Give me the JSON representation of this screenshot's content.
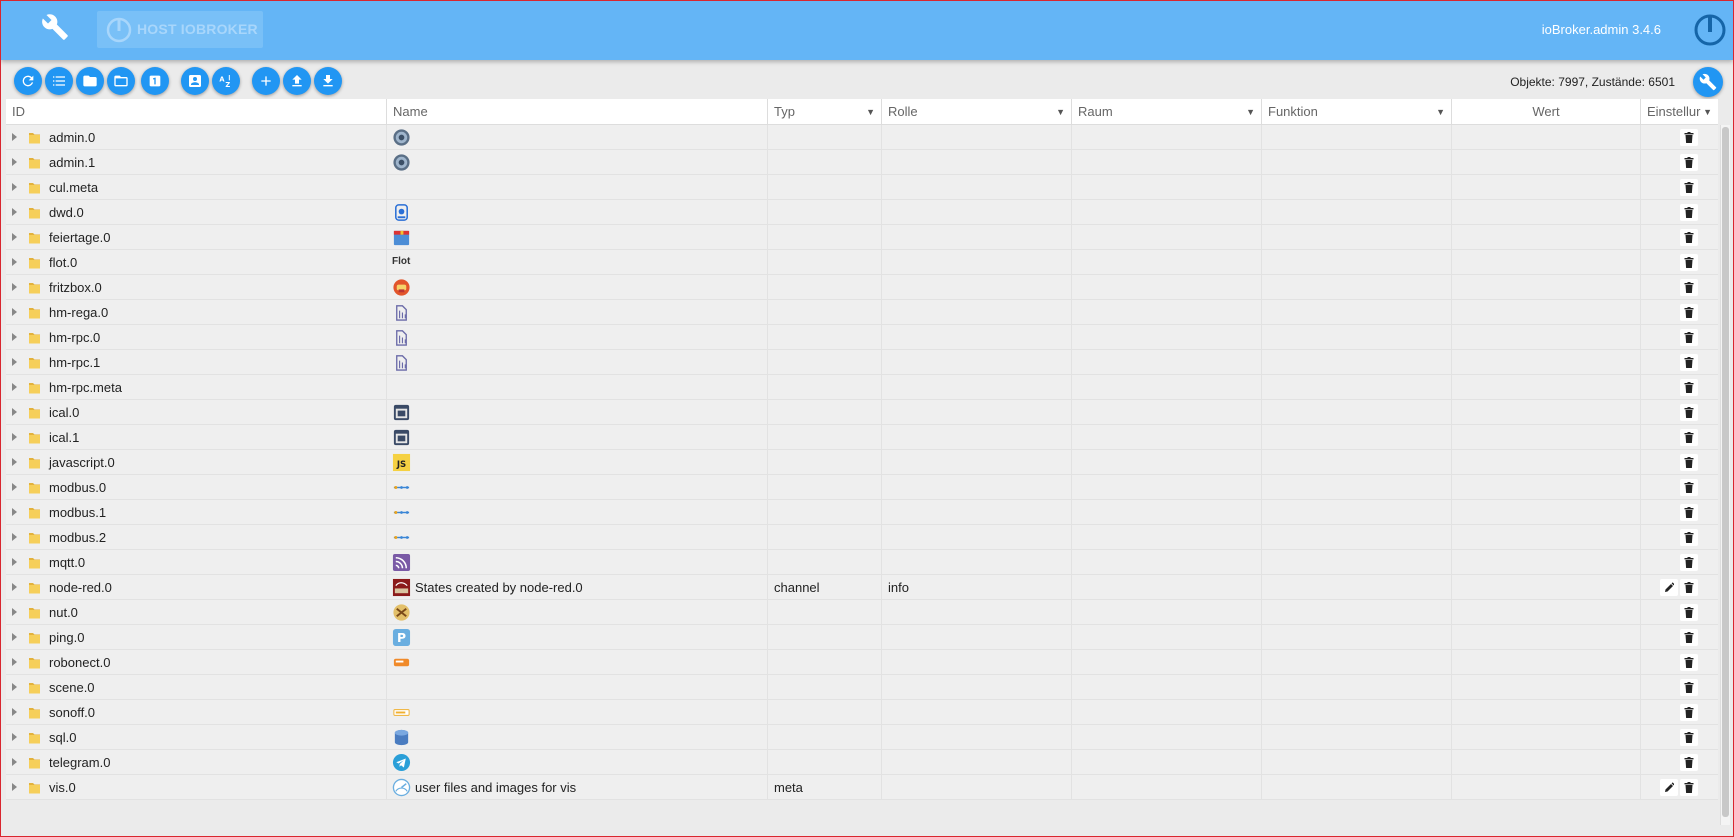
{
  "header": {
    "host_tab": "HOST IOBROKER",
    "version": "ioBroker.admin 3.4.6",
    "colors": {
      "bar": "#64b5f6",
      "accent": "#2196f3"
    }
  },
  "toolbar": {
    "buttons": [
      "refresh-icon",
      "list-view-icon",
      "folder-closed-icon",
      "folder-open-icon",
      "count-one-icon",
      "contact-card-icon",
      "sort-az-icon",
      "add-icon",
      "upload-icon",
      "download-icon"
    ],
    "counts": "Objekte: 7997, Zustände: 6501"
  },
  "table": {
    "headers": {
      "id": "ID",
      "name": "Name",
      "typ": "Typ",
      "rolle": "Rolle",
      "raum": "Raum",
      "funktion": "Funktion",
      "wert": "Wert",
      "einstellungen": "Einstellur"
    },
    "rows": [
      {
        "id": "admin.0",
        "icon": "admin-gear-icon",
        "name": "",
        "typ": "",
        "rolle": "",
        "edit": false
      },
      {
        "id": "admin.1",
        "icon": "admin-gear-icon",
        "name": "",
        "typ": "",
        "rolle": "",
        "edit": false
      },
      {
        "id": "cul.meta",
        "icon": "",
        "name": "",
        "typ": "",
        "rolle": "",
        "edit": false
      },
      {
        "id": "dwd.0",
        "icon": "dwd-weather-icon",
        "name": "",
        "typ": "",
        "rolle": "",
        "edit": false
      },
      {
        "id": "feiertage.0",
        "icon": "calendar-24-icon",
        "name": "",
        "typ": "",
        "rolle": "",
        "edit": false
      },
      {
        "id": "flot.0",
        "icon": "flot-text-icon",
        "icon_text": "Flot",
        "name": "",
        "typ": "",
        "rolle": "",
        "edit": false
      },
      {
        "id": "fritzbox.0",
        "icon": "fritzbox-phone-icon",
        "name": "",
        "typ": "",
        "rolle": "",
        "edit": false
      },
      {
        "id": "hm-rega.0",
        "icon": "homematic-icon",
        "name": "",
        "typ": "",
        "rolle": "",
        "edit": false
      },
      {
        "id": "hm-rpc.0",
        "icon": "homematic-icon",
        "name": "",
        "typ": "",
        "rolle": "",
        "edit": false
      },
      {
        "id": "hm-rpc.1",
        "icon": "homematic-icon",
        "name": "",
        "typ": "",
        "rolle": "",
        "edit": false
      },
      {
        "id": "hm-rpc.meta",
        "icon": "",
        "name": "",
        "typ": "",
        "rolle": "",
        "edit": false
      },
      {
        "id": "ical.0",
        "icon": "ical-calendar-icon",
        "name": "",
        "typ": "",
        "rolle": "",
        "edit": false
      },
      {
        "id": "ical.1",
        "icon": "ical-calendar-icon",
        "name": "",
        "typ": "",
        "rolle": "",
        "edit": false
      },
      {
        "id": "javascript.0",
        "icon": "javascript-icon",
        "icon_text": "JS",
        "name": "",
        "typ": "",
        "rolle": "",
        "edit": false
      },
      {
        "id": "modbus.0",
        "icon": "modbus-icon",
        "name": "",
        "typ": "",
        "rolle": "",
        "edit": false
      },
      {
        "id": "modbus.1",
        "icon": "modbus-icon",
        "name": "",
        "typ": "",
        "rolle": "",
        "edit": false
      },
      {
        "id": "modbus.2",
        "icon": "modbus-icon",
        "name": "",
        "typ": "",
        "rolle": "",
        "edit": false
      },
      {
        "id": "mqtt.0",
        "icon": "mqtt-signal-icon",
        "name": "",
        "typ": "",
        "rolle": "",
        "edit": false
      },
      {
        "id": "node-red.0",
        "icon": "node-red-icon",
        "name": "States created by node-red.0",
        "typ": "channel",
        "rolle": "info",
        "edit": true
      },
      {
        "id": "nut.0",
        "icon": "nut-ups-icon",
        "name": "",
        "typ": "",
        "rolle": "",
        "edit": false
      },
      {
        "id": "ping.0",
        "icon": "ping-p-icon",
        "icon_text": "P",
        "name": "",
        "typ": "",
        "rolle": "",
        "edit": false
      },
      {
        "id": "robonect.0",
        "icon": "robonect-mower-icon",
        "name": "",
        "typ": "",
        "rolle": "",
        "edit": false
      },
      {
        "id": "scene.0",
        "icon": "",
        "name": "",
        "typ": "",
        "rolle": "",
        "edit": false
      },
      {
        "id": "sonoff.0",
        "icon": "sonoff-icon",
        "name": "",
        "typ": "",
        "rolle": "",
        "edit": false
      },
      {
        "id": "sql.0",
        "icon": "database-icon",
        "name": "",
        "typ": "",
        "rolle": "",
        "edit": false
      },
      {
        "id": "telegram.0",
        "icon": "telegram-icon",
        "name": "",
        "typ": "",
        "rolle": "",
        "edit": false
      },
      {
        "id": "vis.0",
        "icon": "vis-gauge-icon",
        "name": "user files and images for vis",
        "typ": "meta",
        "rolle": "",
        "edit": true
      }
    ]
  }
}
